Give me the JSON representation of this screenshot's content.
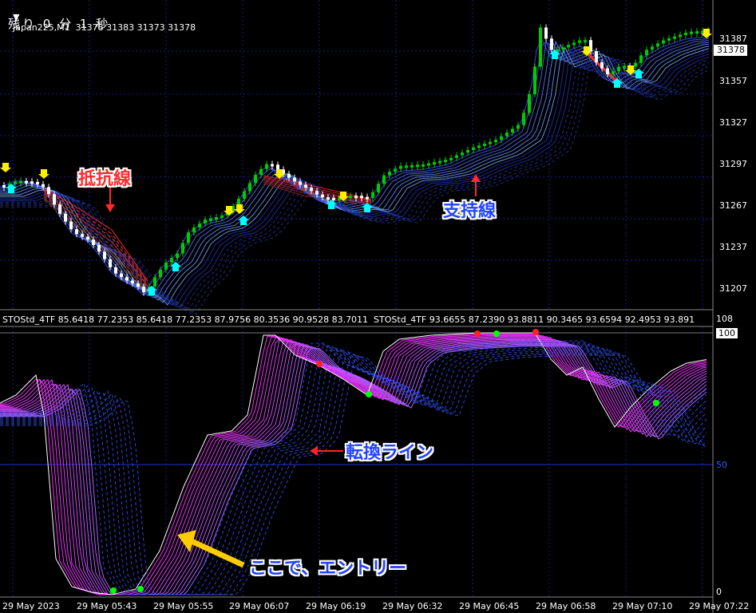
{
  "header": {
    "symbol_line": "Japan225,M1  31378 31383 31373 31378",
    "countdown": "残り 0 分 1 秒"
  },
  "price_axis": {
    "labels": [
      "31387",
      "31357",
      "31327",
      "31297",
      "31267",
      "31237",
      "31207"
    ],
    "current_price": "31378"
  },
  "indicator": {
    "label": "STOStd_4TF 85.6418 77.2353 85.6418 77.2353 87.9756 80.3536 90.9528 83.7011  STOStd_4TF 93.6655 87.2390 93.8811 90.3465 93.6594 92.4953 93.891",
    "top_value": "108",
    "levels": [
      "100",
      "50",
      "0"
    ]
  },
  "time_axis": {
    "labels": [
      "29 May 2023",
      "29 May 05:43",
      "29 May 05:55",
      "29 May 06:07",
      "29 May 06:19",
      "29 May 06:32",
      "29 May 06:45",
      "29 May 06:58",
      "29 May 07:10",
      "29 May 07:22"
    ]
  },
  "annotations": {
    "resistance": "抵抗線",
    "support": "支持線",
    "turning_line": "転換ライン",
    "entry": "ここで、エントリー"
  },
  "colors": {
    "background": "#000000",
    "grid": "#1a1a8c",
    "bull_candle": "#00cc00",
    "bear_candle": "#ffffff",
    "stoch_main": "#ff33ff",
    "stoch_slow": "#3355ff",
    "resistance": "#ff2b2b",
    "support": "#2244ff",
    "arrow_up": "#00ffff",
    "arrow_down": "#ffee00",
    "entry_arrow": "#ffcc00"
  }
}
